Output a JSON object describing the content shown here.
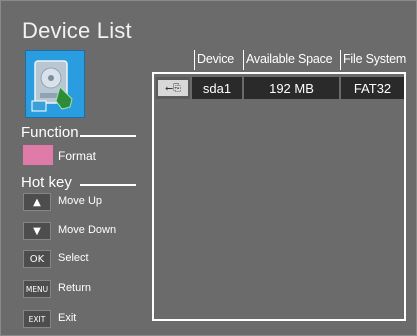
{
  "title": "Device List",
  "icons": {
    "device": "hard-disk-icon",
    "usb": "usb-icon",
    "up": "arrow-up-icon",
    "down": "arrow-down-icon"
  },
  "colors": {
    "background": "#6b6b6b",
    "format_swatch": "#e07aa8",
    "device_icon_bg": "#2a9de0"
  },
  "function": {
    "heading": "Function",
    "items": [
      {
        "label": "Format"
      }
    ]
  },
  "hotkeys": {
    "heading": "Hot key",
    "items": [
      {
        "key": "▲",
        "label": "Move Up"
      },
      {
        "key": "▼",
        "label": "Move Down"
      },
      {
        "key": "OK",
        "label": "Select"
      },
      {
        "key": "MENU",
        "label": "Return"
      },
      {
        "key": "EXIT",
        "label": "Exit"
      }
    ]
  },
  "table": {
    "columns": [
      "Device",
      "Available Space",
      "File System"
    ],
    "rows": [
      {
        "usb_glyph": "⭠⎘",
        "device": "sda1",
        "space": "192 MB",
        "fs": "FAT32"
      }
    ]
  }
}
